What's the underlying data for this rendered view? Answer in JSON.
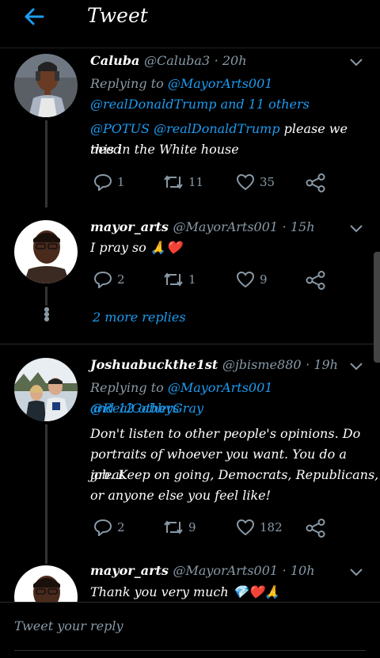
{
  "header": {
    "title": "Tweet"
  },
  "tweets": [
    {
      "name": "Caluba",
      "handle": "@Caluba3",
      "time": "· 20h",
      "replying_prefix": "Replying to",
      "replying_line1": "@MayorArts001",
      "replying_line2": "@realDonaldTrump and 11 others",
      "mentions": "@POTUS @realDonaldTrump",
      "text_line1": "please we need",
      "text_line2": "this in the White house",
      "replies": "1",
      "retweets": "11",
      "likes": "35"
    },
    {
      "name": "mayor_arts",
      "handle": "@MayorArts001",
      "time": "· 15h",
      "text": "I pray so",
      "emoji": "🙏❤️",
      "replies": "2",
      "retweets": "1",
      "likes": "9"
    },
    {
      "name": "Joshuabuckthe1st",
      "handle": "@jbisme880",
      "time": "· 19h",
      "replying_prefix": "Replying to",
      "replying_line1": "@MayorArts001 @RealGabbyGray",
      "replying_line2": "and 12 others",
      "text_lines": [
        "Don't listen to other people's opinions. Do",
        "portraits of whoever you want. You do a great",
        "job. Keep on going, Democrats, Republicans,",
        "or anyone else you feel like!"
      ],
      "replies": "2",
      "retweets": "9",
      "likes": "182"
    },
    {
      "name": "mayor_arts",
      "handle": "@MayorArts001",
      "time": "· 10h",
      "text": "Thank you very much",
      "emoji": "💎❤️🙏"
    }
  ],
  "more_replies": "2 more replies",
  "reply_placeholder": "Tweet your reply",
  "colors": {
    "accent": "#1d9bf0",
    "muted": "#8899a6",
    "background": "#000000"
  },
  "icons": [
    "back-arrow-icon",
    "chevron-down-icon",
    "reply-icon",
    "retweet-icon",
    "like-icon",
    "share-icon"
  ]
}
